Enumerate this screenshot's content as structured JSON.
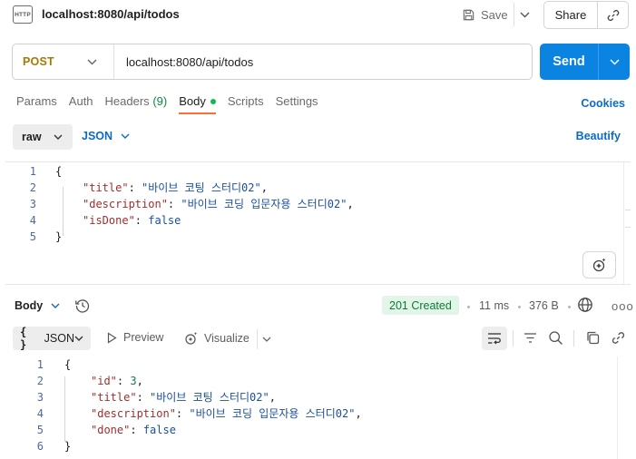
{
  "header": {
    "badge": "HTTP",
    "title": "localhost:8080/api/todos",
    "save_label": "Save",
    "share_label": "Share"
  },
  "request": {
    "method": "POST",
    "url": "localhost:8080/api/todos",
    "send_label": "Send"
  },
  "tabs": {
    "params": "Params",
    "auth": "Auth",
    "headers": "Headers",
    "headers_count": "(9)",
    "body": "Body",
    "scripts": "Scripts",
    "settings": "Settings",
    "active": "Body"
  },
  "cookies_label": "Cookies",
  "body_options": {
    "mode": "raw",
    "language": "JSON",
    "beautify_label": "Beautify"
  },
  "request_body": {
    "line_numbers": [
      "1",
      "2",
      "3",
      "4",
      "5"
    ],
    "open": "{",
    "close": "}",
    "title_key": "\"title\"",
    "title_value": "\"바이브 코팅 스터디02\"",
    "description_key": "\"description\"",
    "description_value": "\"바이브 코딩 입문자용 스터디02\"",
    "isdone_key": "\"isDone\"",
    "isdone_value": "false"
  },
  "response": {
    "title": "Body",
    "status": "201 Created",
    "time": "11 ms",
    "size": "376 B",
    "more": "ooo",
    "format": "JSON",
    "format_brace": "{ }",
    "preview_label": "Preview",
    "visualize_label": "Visualize"
  },
  "response_body": {
    "line_numbers": [
      "1",
      "2",
      "3",
      "4",
      "5",
      "6"
    ],
    "open": "{",
    "close": "}",
    "id_key": "\"id\"",
    "id_value": "3",
    "title_key": "\"title\"",
    "title_value": "\"바이브 코팅 스터디02\"",
    "description_key": "\"description\"",
    "description_value": "\"바이브 코딩 입문자용 스터디02\"",
    "done_key": "\"done\"",
    "done_value": "false"
  },
  "colors": {
    "accent_orange": "#ff6c37",
    "send_blue": "#0a84e0",
    "link_blue": "#0b6cc4",
    "method_post": "#a97800",
    "status_green": "#0b7a35"
  }
}
